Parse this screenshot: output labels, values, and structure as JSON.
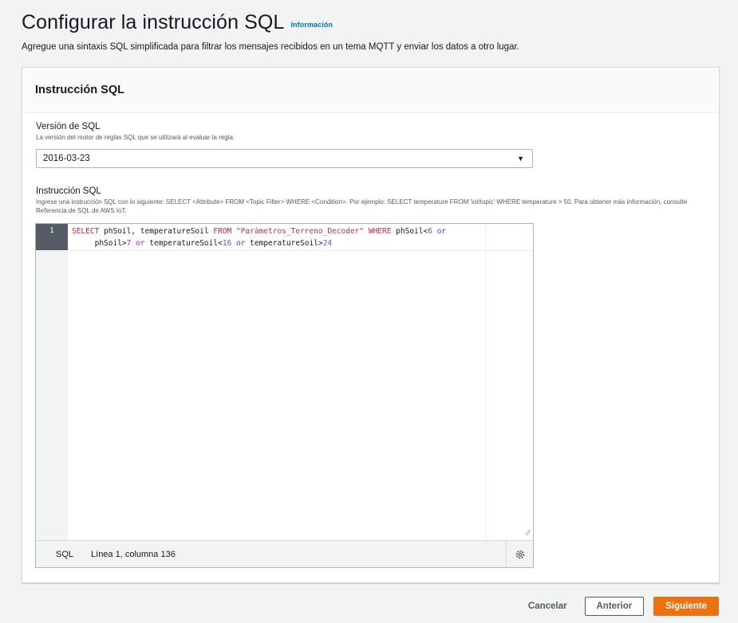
{
  "header": {
    "title": "Configurar la instrucción SQL",
    "info_link": "Información",
    "description": "Agregue una sintaxis SQL simplificada para filtrar los mensajes recibidos en un tema MQTT y enviar los datos a otro lugar."
  },
  "card": {
    "title": "Instrucción SQL",
    "sql_version": {
      "label": "Versión de SQL",
      "description": "La versión del motor de reglas SQL que se utilizará al evaluar la regla.",
      "selected": "2016-03-23"
    },
    "statement": {
      "label": "Instrucción SQL",
      "description": "Ingrese una instrucción SQL con lo siguiente: SELECT <Attribute> FROM <Topic Filter> WHERE <Condition>. Por ejemplo: SELECT temperature FROM 'iot/topic' WHERE temperature > 50. Para obtener más información, consulte Referencia de SQL de AWS IoT."
    },
    "editor": {
      "line_number": "1",
      "line1_tokens": [
        "SELECT",
        " phSoil, temperatureSoil ",
        "FROM",
        " ",
        "\"Parámetros_Terreno_Decoder\"",
        " ",
        "WHERE",
        " phSoil<",
        "6",
        " ",
        "or"
      ],
      "line2_tokens": [
        "phSoil>",
        "7",
        " ",
        "or",
        " temperatureSoil<",
        "16",
        " ",
        "or",
        " temperatureSoil>",
        "24"
      ],
      "status_mode": "SQL",
      "status_position": "Línea 1, columna 136"
    }
  },
  "footer": {
    "cancel": "Cancelar",
    "previous": "Anterior",
    "next": "Siguiente"
  }
}
